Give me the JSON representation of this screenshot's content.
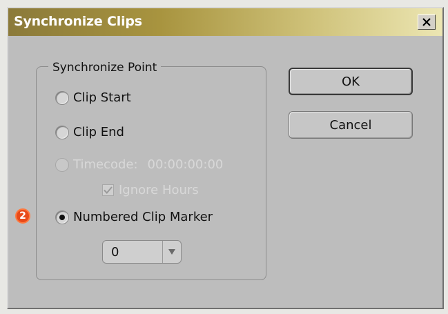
{
  "window": {
    "title": "Synchronize Clips"
  },
  "group": {
    "label": "Synchronize Point",
    "options": [
      {
        "label": "Clip Start",
        "checked": false,
        "enabled": true
      },
      {
        "label": "Clip End",
        "checked": false,
        "enabled": true
      },
      {
        "label": "Timecode:",
        "checked": false,
        "enabled": false,
        "value": "00:00:00:00"
      },
      {
        "label": "Numbered Clip Marker",
        "checked": true,
        "enabled": true
      }
    ],
    "ignore_hours": {
      "label": "Ignore Hours",
      "checked": true,
      "enabled": false
    },
    "marker_select": {
      "value": "0"
    }
  },
  "buttons": {
    "ok": "OK",
    "cancel": "Cancel"
  },
  "annotation": {
    "badge": "2",
    "color": "#e84a1a"
  },
  "colors": {
    "titlebar_start": "#8b7a3a",
    "titlebar_end": "#ece6b3",
    "dialog_bg": "#bdbdbd"
  }
}
